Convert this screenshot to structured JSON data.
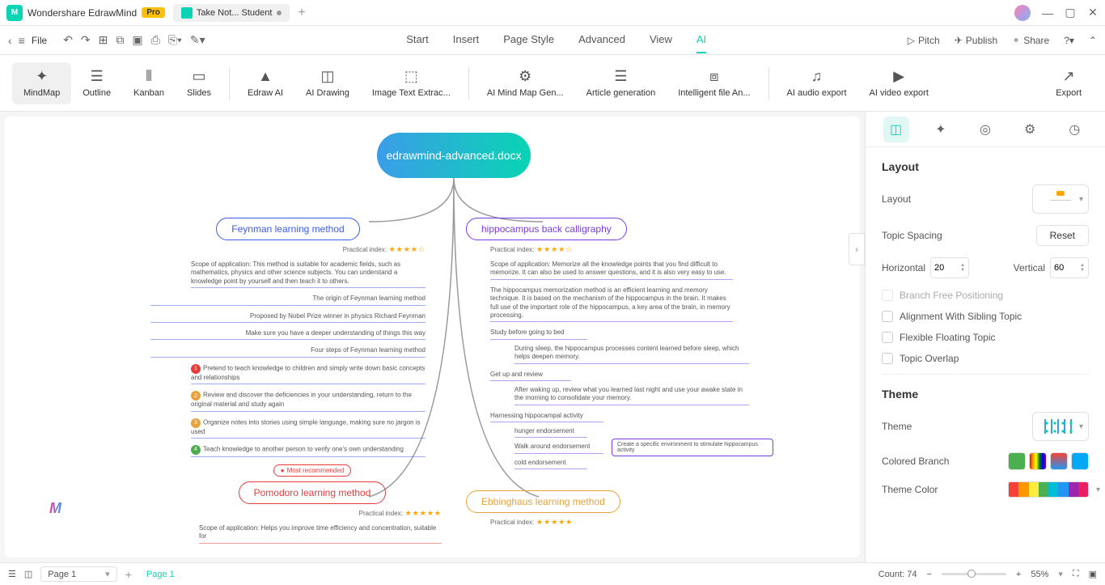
{
  "app": {
    "title": "Wondershare EdrawMind",
    "pro": "Pro"
  },
  "tab": {
    "title": "Take Not... Student"
  },
  "menu": {
    "file": "File",
    "tabs": [
      "Start",
      "Insert",
      "Page Style",
      "Advanced",
      "View",
      "AI"
    ],
    "active_tab": 5,
    "right": {
      "pitch": "Pitch",
      "publish": "Publish",
      "share": "Share"
    }
  },
  "ribbon": {
    "items": [
      "MindMap",
      "Outline",
      "Kanban",
      "Slides",
      "Edraw AI",
      "AI Drawing",
      "Image Text Extrac...",
      "AI Mind Map Gen...",
      "Article generation",
      "Intelligent file An...",
      "AI audio export",
      "AI video export"
    ],
    "export": "Export"
  },
  "mindmap": {
    "root": "edrawmind-advanced.docx",
    "feynman": {
      "title": "Feynman learning method",
      "idx": "Practical index:",
      "scope": "Scope of application: This method is suitable for academic fields, such as mathematics, physics and other science subjects. You can understand a knowledge point by yourself and then teach it to others.",
      "origin": "The origin of Feynman learning method",
      "proposed": "Proposed by Nobel Prize winner in physics Richard Feynman",
      "makesure": "Make sure you have a deeper understanding of things this way",
      "steps": "Four steps of Feynman learning method",
      "s1": "Pretend to teach knowledge to children and simply write down basic concepts and relationships",
      "s2": "Review and discover the deficiencies in your understanding, return to the original material and study again",
      "s3": "Organize notes into stories using simple language, making sure no jargon is used",
      "s4": "Teach knowledge to another person to verify one's own understanding"
    },
    "hippo": {
      "title": "hippocampus back calligraphy",
      "idx": "Practical index:",
      "scope": "Scope of application: Memorize all the knowledge points that you find difficult to memorize. It can also be used to answer questions, and it is also very easy to use.",
      "desc": "The hippocampus memorization method is an efficient learning and memory technique. It is based on the mechanism of the hippocampus in the brain. It makes full use of the important role of the hippocampus, a key area of the brain, in memory processing.",
      "study": "Study before going to bed",
      "study_d": "During sleep, the hippocampus processes content learned before sleep, which helps deepen memory.",
      "getup": "Get up and review",
      "getup_d": "After waking up, review what you learned last night and use your awake state in the morning to consolidate your memory.",
      "harness": "Harnessing hippocampal activity",
      "h1": "hunger endorsement",
      "h2": "Walk around endorsement",
      "h3": "cold endorsement",
      "note": "Create a specific environment to stimulate hippocampus activity"
    },
    "pomodoro": {
      "title": "Pomodoro learning method",
      "rec": "Most recommended",
      "idx": "Practical index:",
      "scope": "Scope of application: Helps you improve time efficiency and concentration, suitable for"
    },
    "ebbing": {
      "title": "Ebbinghaus learning method",
      "idx": "Practical index:"
    }
  },
  "sidebar": {
    "layout": {
      "title": "Layout",
      "layout_label": "Layout",
      "spacing": "Topic Spacing",
      "reset": "Reset",
      "horizontal": "Horizontal",
      "h_val": "20",
      "vertical": "Vertical",
      "v_val": "60",
      "branch_free": "Branch Free Positioning",
      "align_sibling": "Alignment With Sibling Topic",
      "flexible": "Flexible Floating Topic",
      "overlap": "Topic Overlap"
    },
    "theme": {
      "title": "Theme",
      "theme_label": "Theme",
      "colored_branch": "Colored Branch",
      "theme_color": "Theme Color"
    }
  },
  "status": {
    "page_sel": "Page 1",
    "page_tab": "Page 1",
    "count": "Count: 74",
    "zoom": "55%"
  }
}
